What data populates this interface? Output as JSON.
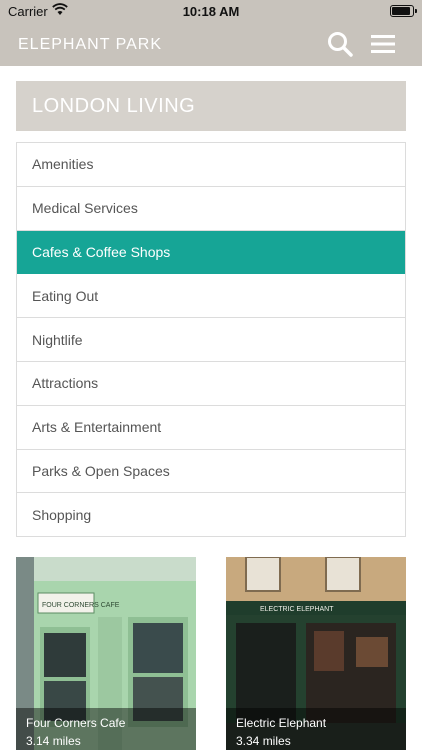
{
  "status_bar": {
    "carrier": "Carrier",
    "time": "10:18 AM"
  },
  "nav": {
    "brand": "ELEPHANT PARK",
    "search_icon": "search-icon",
    "menu_icon": "hamburger-menu-icon"
  },
  "section": {
    "title": "LONDON LIVING"
  },
  "categories": [
    {
      "label": "Amenities",
      "active": false
    },
    {
      "label": "Medical Services",
      "active": false
    },
    {
      "label": "Cafes & Coffee Shops",
      "active": true
    },
    {
      "label": "Eating Out",
      "active": false
    },
    {
      "label": "Nightlife",
      "active": false
    },
    {
      "label": "Attractions",
      "active": false
    },
    {
      "label": "Arts & Entertainment",
      "active": false
    },
    {
      "label": "Parks & Open Spaces",
      "active": false
    },
    {
      "label": "Shopping",
      "active": false
    }
  ],
  "places": [
    {
      "name": "Four Corners Cafe",
      "distance": "3.14 miles",
      "sign_text": "FOUR CORNERS CAFE"
    },
    {
      "name": "Electric Elephant",
      "distance": "3.34 miles",
      "sign_text": "ELECTRIC ELEPHANT"
    }
  ],
  "colors": {
    "accent": "#16a596",
    "header_bg": "#c8c3bc",
    "section_bg": "#d6d2cc"
  }
}
